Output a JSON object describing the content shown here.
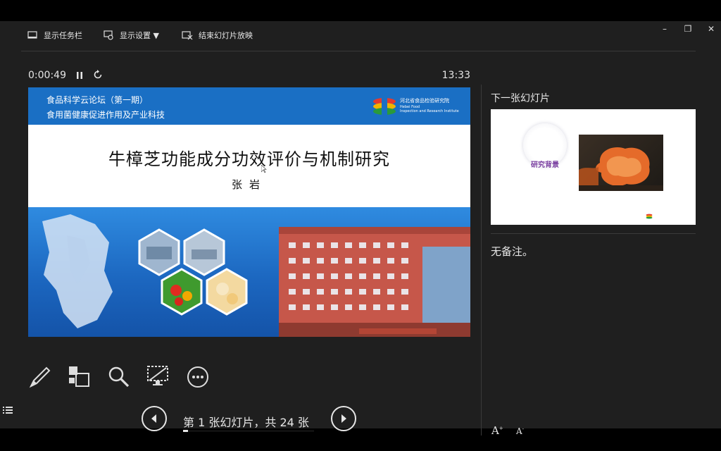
{
  "toolbar": {
    "show_taskbar": "显示任务栏",
    "display_settings": "显示设置 ▼",
    "end_slideshow": "结束幻灯片放映"
  },
  "window_controls": {
    "minimize": "–",
    "restore": "❐",
    "close": "✕"
  },
  "presenter": {
    "elapsed": "0:00:49",
    "clock": "13:33",
    "slide_counter": "第 1 张幻灯片，共 24 张",
    "current_slide_number": 1,
    "total_slides": 24,
    "progress": 0.04
  },
  "current_slide": {
    "header_line1": "食品科学云论坛（第一期）",
    "header_line2": "食用菌健康促进作用及产业科技",
    "logo_cn": "河北省食品检验研究院",
    "logo_en1": "Hebei Food",
    "logo_en2": "Inspection and Research Institute",
    "title": "牛樟芝功能成分功效评价与机制研究",
    "author": "张岩"
  },
  "next_slide": {
    "label": "下一张幻灯片",
    "heading": "研究背景"
  },
  "notes": {
    "text": "无备注。"
  },
  "font_controls": {
    "increase": "A",
    "decrease": "A"
  },
  "colors": {
    "background": "#1f1f1f",
    "slide_blue": "#1a6fc4",
    "text": "#e6e6e6",
    "accent_purple": "#7a3fa0"
  }
}
